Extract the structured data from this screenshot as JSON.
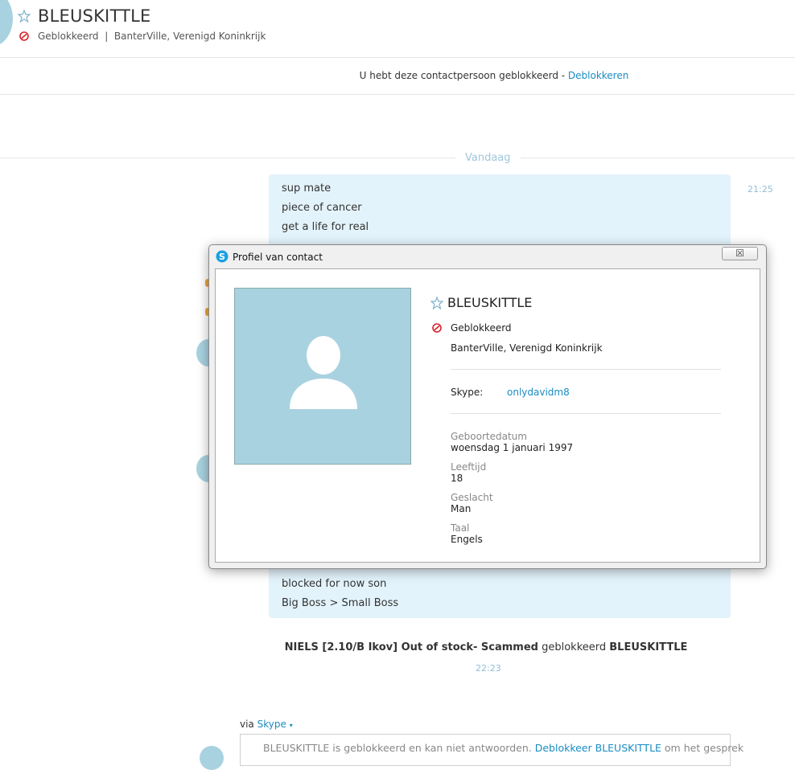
{
  "header": {
    "name": "BLEUSKITTLE",
    "status": "Geblokkeerd",
    "location": "BanterVille, Verenigd Koninkrijk"
  },
  "notice": {
    "text": "U hebt deze contactpersoon geblokkeerd - ",
    "link": "Deblokkeren"
  },
  "date_label": "Vandaag",
  "messages_top": [
    "sup mate",
    "piece of cancer",
    "get a life for real"
  ],
  "time_top": "21:25",
  "messages_bottom": [
    "blocked for now son",
    "Big Boss > Small Boss"
  ],
  "system": {
    "actor": "NIELS [2.10/B Ikov] Out of stock- Scammed",
    "action": " geblokkeerd ",
    "target": "BLEUSKITTLE",
    "time": "22:23"
  },
  "composer": {
    "via_label": "via",
    "via_link": "Skype",
    "text1": "BLEUSKITTLE is geblokkeerd en kan niet antwoorden. ",
    "link": "Deblokkeer BLEUSKITTLE",
    "text2": " om het gesprek"
  },
  "dialog": {
    "title": "Profiel van contact",
    "close": "☒",
    "name": "BLEUSKITTLE",
    "status": "Geblokkeerd",
    "location": "BanterVille, Verenigd Koninkrijk",
    "skype_label": "Skype:",
    "skype_value": "onlydavidm8",
    "fields": [
      {
        "label": "Geboortedatum",
        "value": "woensdag 1 januari 1997"
      },
      {
        "label": "Leeftijd",
        "value": "18"
      },
      {
        "label": "Geslacht",
        "value": "Man"
      },
      {
        "label": "Taal",
        "value": "Engels"
      }
    ]
  },
  "colors": {
    "accent": "#1a8cc2",
    "bubble": "#e3f3fb",
    "avatar": "#a9d2e0",
    "blocked": "#d9232d"
  }
}
